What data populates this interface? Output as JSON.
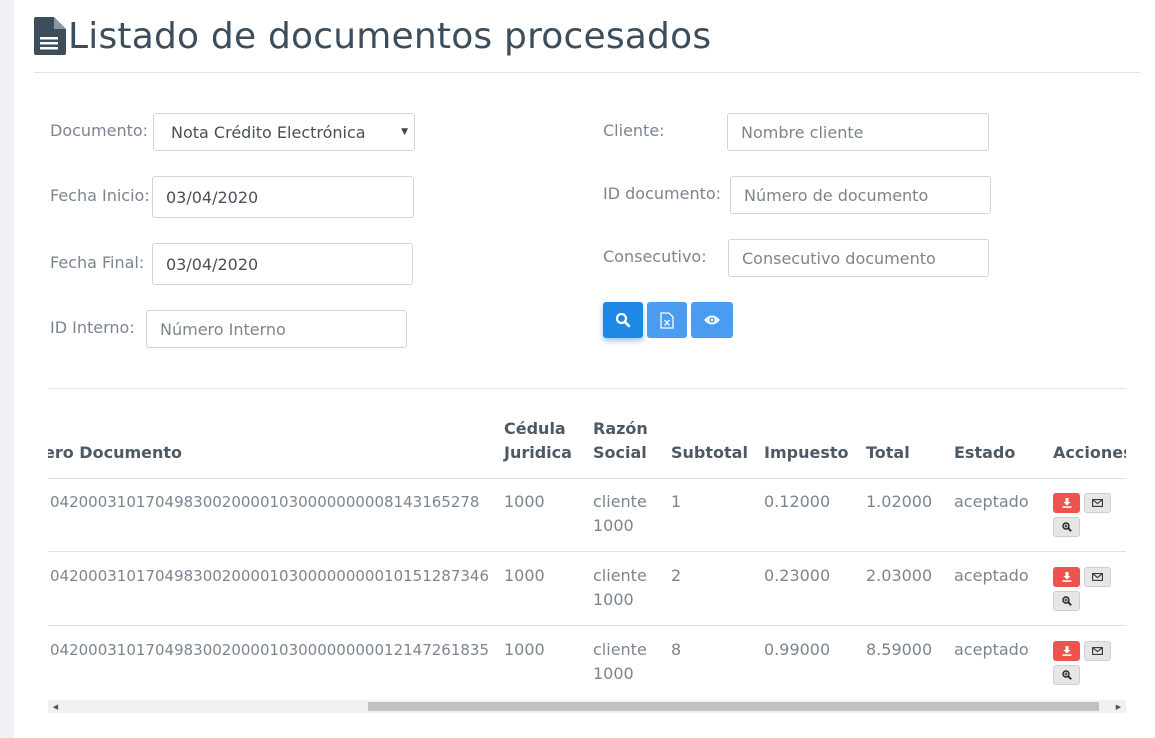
{
  "page": {
    "title": "Listado de documentos procesados"
  },
  "filters": {
    "documento": {
      "label": "Documento:",
      "value": "Nota Crédito Electrónica"
    },
    "fecha_inicio": {
      "label": "Fecha Inicio:",
      "value": "03/04/2020"
    },
    "fecha_final": {
      "label": "Fecha Final:",
      "value": "03/04/2020"
    },
    "id_interno": {
      "label": "ID Interno:",
      "placeholder": "Número Interno"
    },
    "cliente": {
      "label": "Cliente:",
      "placeholder": "Nombre cliente"
    },
    "id_documento": {
      "label": "ID documento:",
      "placeholder": "Número de documento"
    },
    "consecutivo": {
      "label": "Consecutivo:",
      "placeholder": "Consecutivo documento"
    }
  },
  "buttons": {
    "search_icon": "search-icon",
    "excel_icon": "excel-icon",
    "view_icon": "eye-icon",
    "colors": {
      "primary": "#1e88e5",
      "secondary": "#4a9cf1",
      "danger": "#ef5350"
    }
  },
  "table": {
    "headers": {
      "numero": "ero Documento",
      "cedula_1": "Cédula",
      "cedula_2": "Juridica",
      "razon_1": "Razón",
      "razon_2": "Social",
      "subtotal": "Subtotal",
      "impuesto": "Impuesto",
      "total": "Total",
      "estado": "Estado",
      "acciones": "Acciones"
    },
    "rows": [
      {
        "numero": "04200031017049830020000103000000000814316527​8",
        "cedula": "1000",
        "razon_1": "cliente",
        "razon_2": "1000",
        "subtotal": "1",
        "impuesto": "0.12000",
        "total": "1.02000",
        "estado": "aceptado"
      },
      {
        "numero": "04200031017049830020000103000000000101512873​46",
        "cedula": "1000",
        "razon_1": "cliente",
        "razon_2": "1000",
        "subtotal": "2",
        "impuesto": "0.23000",
        "total": "2.03000",
        "estado": "aceptado"
      },
      {
        "numero": "04200031017049830020000103000000000121472618​35",
        "cedula": "1000",
        "razon_1": "cliente",
        "razon_2": "1000",
        "subtotal": "8",
        "impuesto": "0.99000",
        "total": "8.59000",
        "estado": "aceptado"
      }
    ]
  }
}
